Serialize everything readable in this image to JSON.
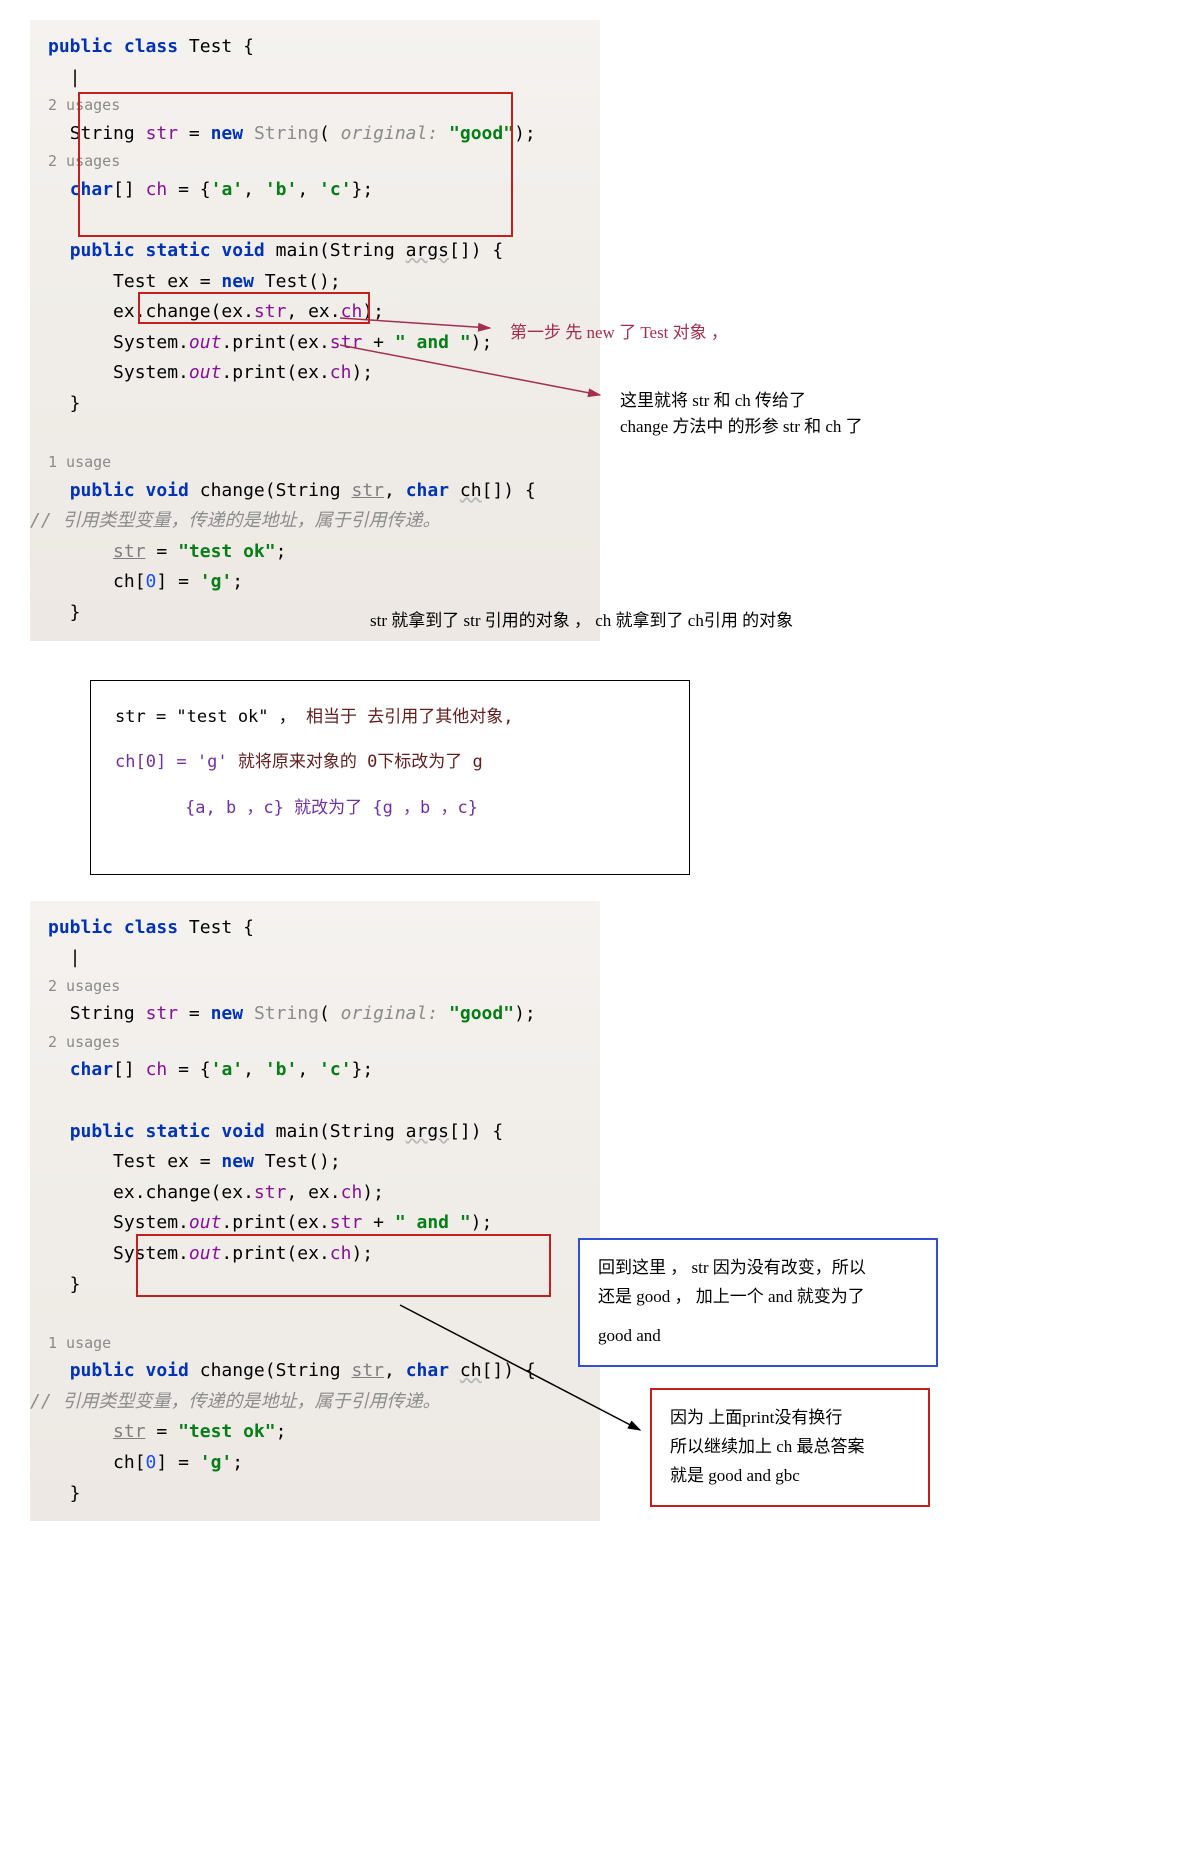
{
  "block1": {
    "class_decl": "public class Test {",
    "usages1": "2 usages",
    "line_str": "String str = new String( original: \"good\");",
    "usages2": "2 usages",
    "line_ch": "char[] ch = {'a', 'b', 'c'};",
    "main_sig": "public static void main(String args[]) {",
    "main_l1": "Test ex = new Test();",
    "main_l2": "ex.change(ex.str, ex.ch);",
    "main_l3": "System.out.print(ex.str + \" and \");",
    "main_l4": "System.out.print(ex.ch);",
    "close1": "}",
    "usages3": "1 usage",
    "change_sig": "public void change(String str, char ch[]) {",
    "comment": "// 引用类型变量，传递的是地址，属于引用传递。",
    "change_l1": "str = \"test ok\";",
    "change_l2": "ch[0] = 'g';",
    "close2": "}"
  },
  "anno1": "第一步 先 new 了 Test 对象 ，",
  "anno2_l1": "这里就将 str 和 ch 传给了",
  "anno2_l2": "change 方法中 的形参 str 和 ch 了",
  "anno3": "str 就拿到了 str 引用的对象 ， ch 就拿到了 ch引用 的对象",
  "notebox": {
    "l1a": "str = \"test ok\" ， ",
    "l1b": " 相当于 去引用了其他对象,",
    "l2a": "ch[0] = 'g'  ",
    "l2b": " 就将原来对象的 0下标改为了 g",
    "l3": "{a, b ，c} 就改为了 {g ，b ，c}"
  },
  "callout_blue": {
    "l1": "回到这里 ， str 因为没有改变，所以",
    "l2": "还是 good ， 加上一个 and 就变为了",
    "l3": "good and"
  },
  "callout_red": {
    "l1": "因为 上面print没有换行",
    "l2": "所以继续加上 ch 最总答案",
    "l3": "就是 good and gbc"
  }
}
